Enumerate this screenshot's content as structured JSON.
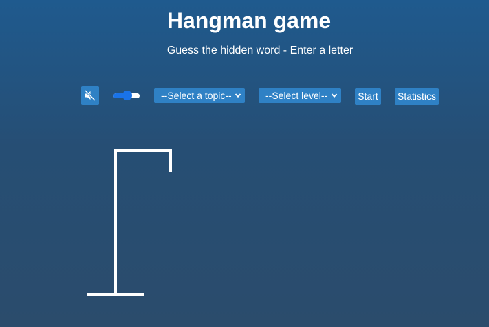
{
  "header": {
    "title": "Hangman game",
    "subtitle": "Guess the hidden word - Enter a letter"
  },
  "controls": {
    "mute_icon": "speaker-muted-icon",
    "sound_toggle_state": "on",
    "topic_select": {
      "selected": "--Select a topic--"
    },
    "level_select": {
      "selected": "--Select level--"
    },
    "start_label": "Start",
    "statistics_label": "Statistics"
  },
  "colors": {
    "background_top": "#1f5a8e",
    "background_bottom": "#2b4c6c",
    "button": "#2f81c5",
    "toggle_accent": "#1a73e8",
    "gallows": "#ffffff"
  },
  "game": {
    "wrong_guesses": 0,
    "gallows_icon": "gallows-icon"
  }
}
